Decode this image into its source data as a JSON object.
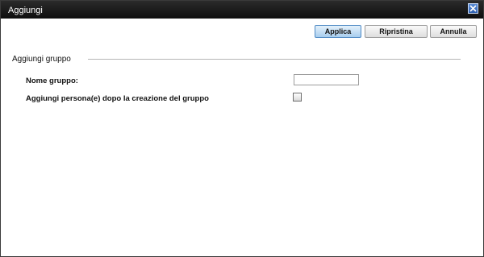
{
  "dialog": {
    "title": "Aggiungi",
    "close_icon": "close-icon"
  },
  "toolbar": {
    "apply_label": "Applica",
    "reset_label": "Ripristina",
    "cancel_label": "Annulla"
  },
  "section": {
    "title": "Aggiungi gruppo"
  },
  "form": {
    "group_name_label": "Nome gruppo:",
    "group_name_value": "",
    "add_people_label": "Aggiungi persona(e) dopo la creazione del gruppo",
    "add_people_checked": false
  },
  "colors": {
    "titlebar": "#0e0e0e",
    "primary_button": "#a8cdee"
  }
}
